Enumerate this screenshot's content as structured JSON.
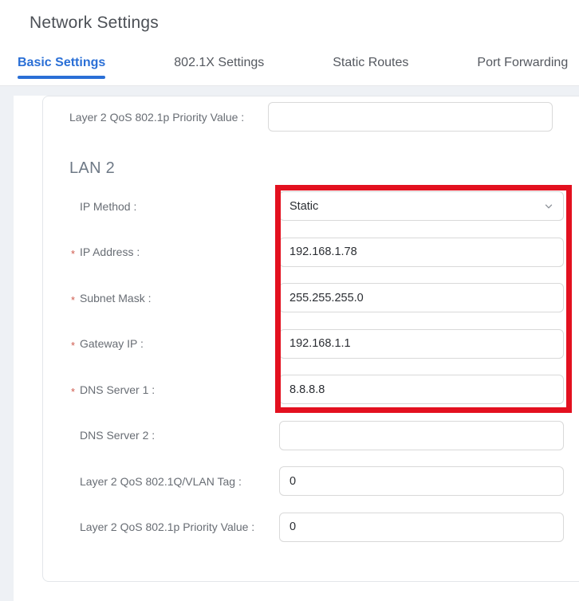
{
  "page": {
    "title": "Network Settings"
  },
  "tabs": [
    {
      "label": "Basic Settings",
      "active": true
    },
    {
      "label": "802.1X Settings",
      "active": false
    },
    {
      "label": "Static Routes",
      "active": false
    },
    {
      "label": "Port Forwarding",
      "active": false
    }
  ],
  "colors": {
    "accent_blue": "#2a6fd6",
    "highlight_red": "#e3101f",
    "required_asterisk": "#cf5a4d",
    "page_background": "#eef1f5"
  },
  "form": {
    "required_marker": "*",
    "pre_row": {
      "label": "Layer 2 QoS 802.1p Priority Value :",
      "value": "",
      "required": false
    },
    "section": {
      "heading": "LAN 2"
    },
    "rows": [
      {
        "label": "IP Method :",
        "type": "select",
        "value": "Static",
        "required": false
      },
      {
        "label": "IP Address :",
        "type": "input",
        "value": "192.168.1.78",
        "required": true
      },
      {
        "label": "Subnet Mask :",
        "type": "input",
        "value": "255.255.255.0",
        "required": true
      },
      {
        "label": "Gateway IP :",
        "type": "input",
        "value": "192.168.1.1",
        "required": true
      },
      {
        "label": "DNS Server 1 :",
        "type": "input",
        "value": "8.8.8.8",
        "required": true
      },
      {
        "label": "DNS Server 2 :",
        "type": "input",
        "value": "",
        "required": false
      },
      {
        "label": "Layer 2 QoS 802.1Q/VLAN Tag :",
        "type": "input",
        "value": "0",
        "required": false
      },
      {
        "label": "Layer 2 QoS 802.1p Priority Value :",
        "type": "input",
        "value": "0",
        "required": false
      }
    ],
    "highlight_note": "red box highlights IP Method through DNS Server 1"
  },
  "icons": {
    "select_chevron": "chevron-down-icon"
  }
}
